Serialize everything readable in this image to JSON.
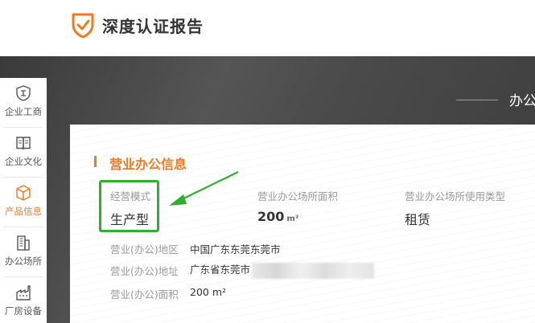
{
  "header": {
    "brand_text": "深度认证报告"
  },
  "banner": {
    "title": "办公"
  },
  "sidebar": {
    "items": [
      {
        "label": "企业工商",
        "icon": "shield-icon",
        "active": false
      },
      {
        "label": "企业文化",
        "icon": "book-icon",
        "active": false
      },
      {
        "label": "产品信息",
        "icon": "box-icon",
        "active": true
      },
      {
        "label": "办公场所",
        "icon": "building-icon",
        "active": false
      },
      {
        "label": "厂房设备",
        "icon": "factory-icon",
        "active": false
      }
    ]
  },
  "section": {
    "title": "营业办公信息",
    "fields": {
      "mode": {
        "label": "经营模式",
        "value": "生产型"
      },
      "area": {
        "label": "营业办公场所面积",
        "value": "200",
        "unit": "m²"
      },
      "usage": {
        "label": "营业办公场所使用类型",
        "value": "租赁"
      }
    },
    "rows": [
      {
        "label": "营业(办公)地区",
        "value": "中国广东东莞东莞市"
      },
      {
        "label": "营业(办公)地址",
        "value": "广东省东莞市"
      },
      {
        "label": "营业(办公)面积",
        "value": "200 m²"
      }
    ]
  },
  "colors": {
    "accent": "#ef7a22",
    "highlight": "#2fae2f"
  }
}
